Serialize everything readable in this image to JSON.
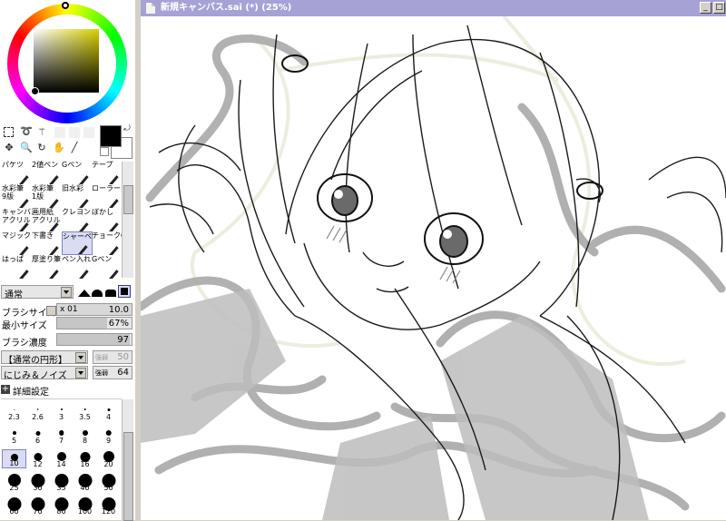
{
  "window": {
    "title": "新規キャンバス.sai (*) (25%)"
  },
  "colors": {
    "accent_title": "#a6a2d6",
    "selected_bg": "#d9dcf2",
    "current_color": "#000000",
    "secondary_color": "#ffffff",
    "picker_hue": "#d8d000"
  },
  "tools": {
    "row1": [
      "パケツ",
      "2値ペン",
      "Gペン",
      "テープ"
    ],
    "row2": [
      "水彩筆\n9版",
      "水彩筆\n1版",
      "旧水彩",
      "ローラー"
    ],
    "row3": [
      "キャンバス\nアクリル",
      "画用紙\nアクリル",
      "クレヨン",
      "ぼかし"
    ],
    "row4": [
      "マジック",
      "下書き",
      "シャーペン",
      "チョークG/W"
    ],
    "row5": [
      "はっぱ",
      "厚塗り筆",
      "ペン入れ",
      "Gペン"
    ],
    "selected": "シャーペン"
  },
  "brush": {
    "blend_mode": "通常",
    "size_label": "ブラシサイズ",
    "size_multiplier": "x 01",
    "size_value": "10.0",
    "min_size_label": "最小サイズ",
    "min_size_value": "67%",
    "min_size_fraction": 0.67,
    "density_label": "ブラシ濃度",
    "density_value": "97",
    "density_fraction": 0.97,
    "shape": "【通常の円形】",
    "shape_strength_label": "強弱",
    "shape_strength_value": "50",
    "texture": "にじみ＆ノイズ",
    "texture_strength_label": "強弱",
    "texture_strength_value": "64",
    "advanced_label": "詳細設定"
  },
  "size_presets": {
    "labels": [
      "2.3",
      "2.6",
      "3",
      "3.5",
      "4",
      "5",
      "6",
      "7",
      "8",
      "9",
      "10",
      "12",
      "14",
      "16",
      "20",
      "25",
      "30",
      "35",
      "40",
      "50",
      "60",
      "70",
      "80",
      "100",
      "120"
    ],
    "selected": "10"
  }
}
